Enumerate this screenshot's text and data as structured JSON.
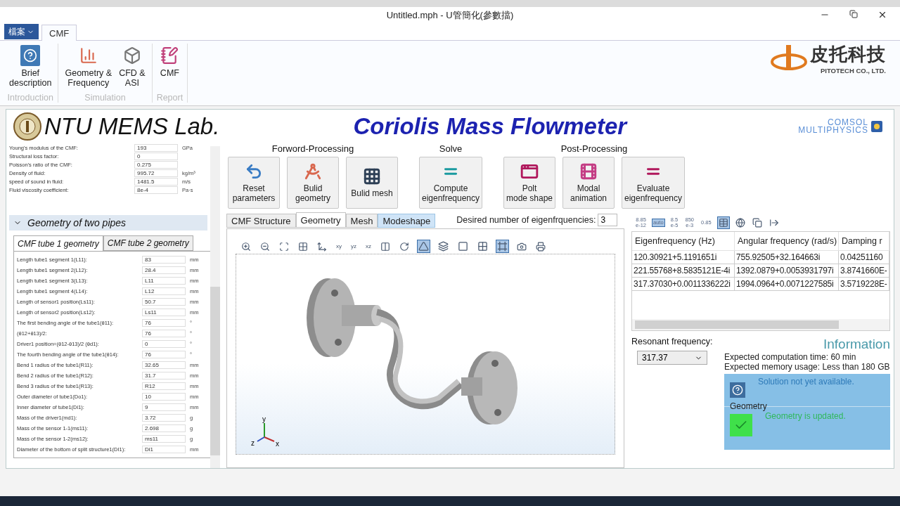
{
  "window": {
    "title": "Untitled.mph - U管簡化(參數擋)"
  },
  "ribbon": {
    "file_menu": "檔案",
    "tabs": [
      {
        "label": "CMF",
        "selected": true
      }
    ],
    "groups": [
      {
        "label": "Introduction",
        "buttons": [
          {
            "label": "Brief\ndescription",
            "kind": "help"
          }
        ]
      },
      {
        "label": "Simulation",
        "buttons": [
          {
            "label": "Geometry &\nFrequency",
            "kind": "chart"
          },
          {
            "label": "CFD &\nASI",
            "kind": "cfd"
          }
        ]
      },
      {
        "label": "Report",
        "buttons": [
          {
            "label": "CMF",
            "kind": "report"
          }
        ]
      }
    ]
  },
  "company_logo": {
    "name": "皮托科技",
    "subtitle": "PITOTECH CO., LTD."
  },
  "header": {
    "lab": "NTU MEMS Lab.",
    "title": "Coriolis Mass Flowmeter",
    "brand": "COMSOL",
    "brand_sub": "MULTIPHYSICS"
  },
  "material_params": [
    {
      "label": "Young's modulus of the CMF:",
      "value": "193",
      "unit": "GPa"
    },
    {
      "label": "Structural loss factor:",
      "value": "0"
    },
    {
      "label": "Poisson's ratio of the CMF:",
      "value": "0.275"
    },
    {
      "label": "Density of fluid:",
      "value": "995.72",
      "unit": "kg/m³"
    },
    {
      "label": "speed of sound in fluid:",
      "value": "1481.5",
      "unit": "m/s"
    },
    {
      "label": "Fluid viscosity coefficient:",
      "value": "8e-4",
      "unit": "Pa·s"
    }
  ],
  "geometry_section": {
    "title": "Geometry of two pipes",
    "expanded": true,
    "tabs": [
      {
        "label": "CMF tube 1 geometry",
        "selected": true
      },
      {
        "label": "CMF tube 2 geometry",
        "selected": false
      }
    ],
    "params": [
      {
        "label": "Length tube1 segment 1(L11):",
        "value": "83",
        "unit": "mm"
      },
      {
        "label": "Length tube1 segment 2(L12):",
        "value": "28.4",
        "unit": "mm"
      },
      {
        "label": "Length tube1 segment 3(L13):",
        "value": "L11",
        "unit": "mm"
      },
      {
        "label": "Length tube1 segment 4(L14):",
        "value": "L12",
        "unit": "mm"
      },
      {
        "label": "Length of sensor1 position(Ls11):",
        "value": "50.7",
        "unit": "mm"
      },
      {
        "label": "Length of sensor2 position(Ls12):",
        "value": "Ls11",
        "unit": "mm"
      },
      {
        "label": "The first bending angle of the tube1(θ11):",
        "value": "76",
        "unit": "°"
      },
      {
        "label": "(θ12+θ13)/2:",
        "value": "76",
        "unit": "°"
      },
      {
        "label": "Driver1 position=(θ12-θ13)/2 (θd1):",
        "value": "0",
        "unit": "°"
      },
      {
        "label": "The fourth bending angle of the tube1(θ14):",
        "value": "76",
        "unit": "°"
      },
      {
        "label": "Bend 1 radius of the tube1(R11):",
        "value": "32.65",
        "unit": "mm"
      },
      {
        "label": "Bend 2 radius of the tube1(R12):",
        "value": "31.7",
        "unit": "mm"
      },
      {
        "label": "Bend 3 radius of the tube1(R13):",
        "value": "R12",
        "unit": "mm"
      },
      {
        "label": "Outer diameter of tube1(Do1):",
        "value": "10",
        "unit": "mm"
      },
      {
        "label": "Inner diameter of tube1(Di1):",
        "value": "9",
        "unit": "mm"
      },
      {
        "label": "Mass of the driver1(md1):",
        "value": "3.72",
        "unit": "g"
      },
      {
        "label": "Mass of the sensor 1-1(ms11):",
        "value": "2.698",
        "unit": "g"
      },
      {
        "label": "Mass of the sensor 1-2(ms12):",
        "value": "ms11",
        "unit": "g"
      },
      {
        "label": "Diameter of the bottom of split structure1(DI1):",
        "value": "Di1",
        "unit": "mm"
      }
    ]
  },
  "action_groups": [
    {
      "title": "Forword-Processing",
      "buttons": [
        {
          "label": "Reset\nparameters",
          "kind": "reset"
        },
        {
          "label": "Bulid\ngeometry",
          "kind": "geometry"
        },
        {
          "label": "Bulid mesh",
          "kind": "mesh"
        }
      ]
    },
    {
      "title": "Solve",
      "buttons": [
        {
          "label": "Compute\neigenfrequency",
          "kind": "compute"
        }
      ]
    },
    {
      "title": "Post-Processing",
      "buttons": [
        {
          "label": "Polt\nmode shape",
          "kind": "plot"
        },
        {
          "label": "Modal\nanimation",
          "kind": "animation"
        },
        {
          "label": "Evaluate\neigenfrequency",
          "kind": "evaluate"
        }
      ]
    }
  ],
  "view_tabs": [
    {
      "label": "CMF Structure",
      "selected": false,
      "hovered": false
    },
    {
      "label": "Geometry",
      "selected": true,
      "hovered": false
    },
    {
      "label": "Mesh",
      "selected": false,
      "hovered": false
    },
    {
      "label": "Modeshape",
      "selected": false,
      "hovered": true
    }
  ],
  "eigen_count": {
    "label": "Desired number of eigenfrquencies:",
    "value": "3"
  },
  "graphics": {
    "view_buttons": [
      "xy",
      "yz",
      "xz"
    ],
    "toggles": [
      {
        "kind": "lights",
        "selected": true
      },
      {
        "kind": "transparency",
        "selected": false
      },
      {
        "kind": "wireframe",
        "selected": false
      },
      {
        "kind": "grid",
        "selected": false
      },
      {
        "kind": "frame",
        "selected": true
      }
    ],
    "axes": {
      "x": "x",
      "y": "y",
      "z": "z"
    }
  },
  "results": {
    "format_buttons": [
      {
        "label": "8.85\ne-12",
        "selected": false
      },
      {
        "label": "auto",
        "selected": true
      },
      {
        "label": "8.5\ne-5",
        "selected": false
      },
      {
        "label": "850\ne-3",
        "selected": false
      },
      {
        "label": "0.85",
        "selected": false
      }
    ],
    "columns": [
      "Eigenfrequency (Hz)",
      "Angular frequency (rad/s)",
      "Damping r"
    ],
    "rows": [
      [
        "120.30921+5.1191651i",
        "755.92505+32.164663i",
        "0.04251160"
      ],
      [
        "221.55768+8.5835121E-4i",
        "1392.0879+0.0053931797i",
        "3.8741660E-"
      ],
      [
        "317.37030+0.0011336222i",
        "1994.0964+0.0071227585i",
        "3.5719228E-"
      ]
    ]
  },
  "resonant": {
    "label": "Resonant frequency:",
    "value": "317.37"
  },
  "information": {
    "title": "Information",
    "lines": [
      "Expected computation time: 60 min",
      "Expected memory usage:  Less than 180 GB"
    ],
    "solution_status": "Solution not yet available.",
    "geometry_heading": "Geometry",
    "geometry_status": "Geometry is updated."
  }
}
